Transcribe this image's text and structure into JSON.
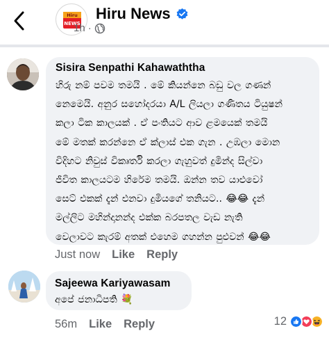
{
  "header": {
    "page_name": "Hiru News",
    "time": "1h",
    "dot": "·",
    "avatar_brand_top": "Hiru",
    "avatar_brand_bottom": "NEWS"
  },
  "comments": [
    {
      "author": "Sisira Senpathi Kahawaththa",
      "lines": [
        "හිරු නම් පවම තමයි . මේ කියන්නෙ බඩු වල ගණන්",
        "නෙමෙයි. අනුර සහෝදරයා A/L ලියලා ගණිතය ටියුෂන්",
        "කලා ටික කාලයක් . ඒ පංතියට ආව ළමයෙක් තමයි",
        "මේ මතක් කරන්නෙ ඒ ක්ලාස් එක ගැන . උඹලා මොන",
        "විදිහට නිවුස් විකෘර්ති කරලා ගැහුවත් දුමින්ද සිල්වා",
        "ජීවිත කාලයටම හිරේම තමයි. ඔන්න තව යාළුවෝ",
        "සෙට් එකක් දැන් එනවා දුමියගේ තනියට.. 😂😂 දැන්",
        "මල්ලිට මහින්දානන්ද එක්ක බරපතල වැඩ නැති",
        "වෙලාවට කැරම් අතක් එහෙම ගහන්න පුළුවන් 😂😂"
      ],
      "time": "Just now",
      "like": "Like",
      "reply": "Reply"
    },
    {
      "author": "Sajeewa Kariyawasam",
      "text": "අපේ ජනාධිපති 💐",
      "time": "56m",
      "like": "Like",
      "reply": "Reply",
      "reaction_count": "12",
      "reaction_icons": [
        "like-icon",
        "love-icon",
        "haha-icon"
      ]
    }
  ],
  "colors": {
    "like_blue": "#1877f2",
    "love_red": "#f33e58",
    "haha_yellow": "#f7b125",
    "bubble_bg": "#f0f2f5",
    "meta_gray": "#65676b"
  }
}
